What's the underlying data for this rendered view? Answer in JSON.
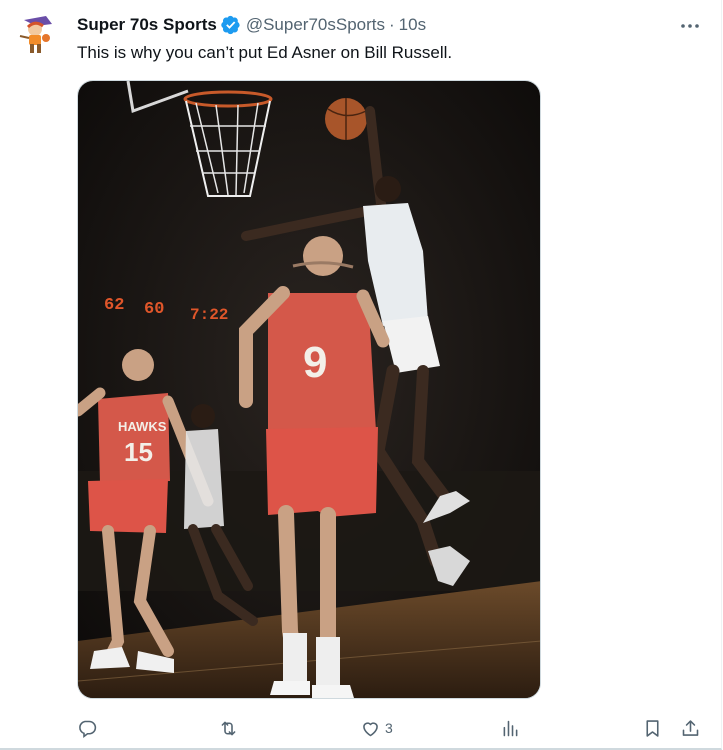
{
  "tweet": {
    "display_name": "Super 70s Sports",
    "handle": "@Super70sSports",
    "separator": "·",
    "time": "10s",
    "text": "This is why you can’t put Ed Asner on Bill Russell.",
    "media": {
      "scoreboard": [
        "62",
        "60",
        "7:22"
      ],
      "jersey_numbers": [
        "9",
        "15"
      ],
      "jersey_lettering": "HAWKS"
    }
  },
  "actions": {
    "reply_count": "",
    "retweet_count": "",
    "like_count": "3",
    "views_count": ""
  },
  "icons": [
    "avatar",
    "verified-badge-icon",
    "more-options-icon",
    "reply-icon",
    "retweet-icon",
    "like-icon",
    "views-icon",
    "bookmark-icon",
    "share-icon"
  ],
  "colors": {
    "verified_blue": "#1d9bf0",
    "text_secondary": "#536471",
    "text_primary": "#0f1419"
  }
}
